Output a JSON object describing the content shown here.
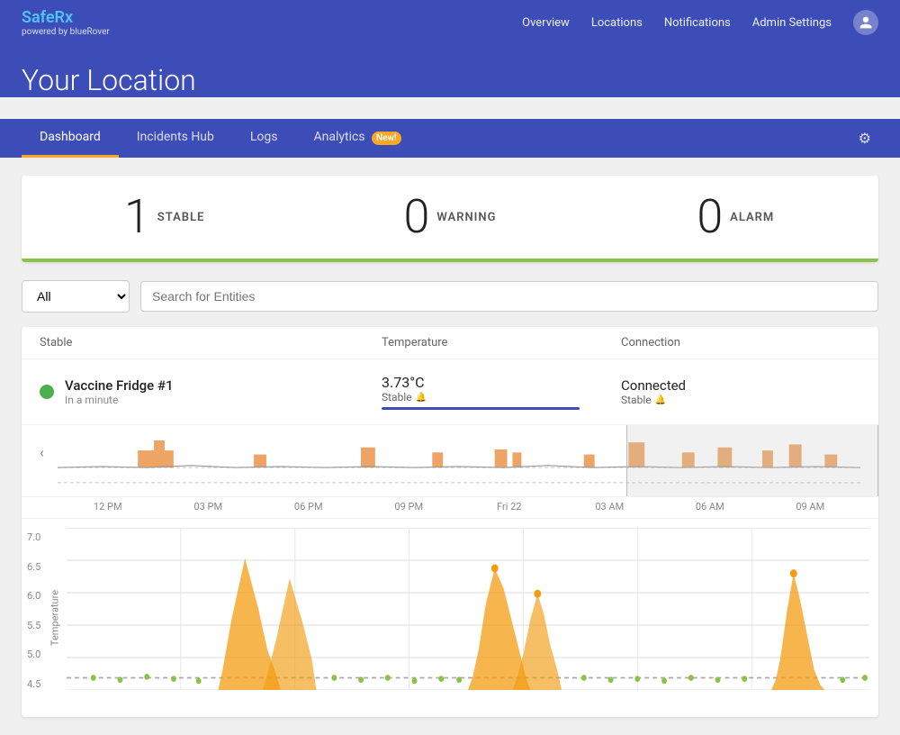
{
  "brand": {
    "name_safe": "Safe",
    "name_rx": "Rx",
    "powered_by": "powered by blueRover"
  },
  "top_nav": {
    "items": [
      {
        "label": "Overview",
        "active": false
      },
      {
        "label": "Locations",
        "active": false
      },
      {
        "label": "Notifications",
        "active": false
      },
      {
        "label": "Admin Settings",
        "active": false
      }
    ]
  },
  "location": {
    "title": "Your Location"
  },
  "sub_nav": {
    "tabs": [
      {
        "label": "Dashboard",
        "active": true,
        "badge": null
      },
      {
        "label": "Incidents Hub",
        "active": false,
        "badge": null
      },
      {
        "label": "Logs",
        "active": false,
        "badge": null
      },
      {
        "label": "Analytics",
        "active": false,
        "badge": "New!"
      }
    ],
    "settings_label": "⚙"
  },
  "stats": {
    "stable": {
      "count": "1",
      "label": "STABLE"
    },
    "warning": {
      "count": "0",
      "label": "WARNING"
    },
    "alarm": {
      "count": "0",
      "label": "ALARM"
    }
  },
  "filter": {
    "select_label": "All",
    "search_placeholder": "Search for Entities"
  },
  "columns": {
    "name": "Stable",
    "temperature": "Temperature",
    "connection": "Connection"
  },
  "entities": [
    {
      "name": "Vaccine Fridge #1",
      "sub": "In a minute",
      "status": "stable",
      "temperature": "3.73°C",
      "temp_status": "Stable",
      "connection": "Connected",
      "conn_status": "Stable"
    }
  ],
  "chart": {
    "time_labels": [
      "12 PM",
      "03 PM",
      "06 PM",
      "09 PM",
      "Fri 22",
      "03 AM",
      "06 AM",
      "09 AM"
    ],
    "y_axis_label": "Temperature",
    "y_ticks": [
      "7.0",
      "6.5",
      "6.0",
      "5.5",
      "5.0",
      "4.5"
    ]
  }
}
